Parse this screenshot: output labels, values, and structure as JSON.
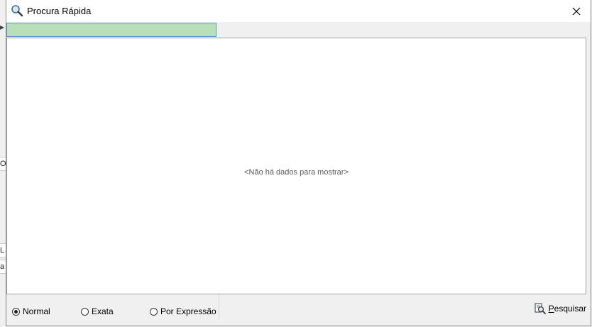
{
  "window": {
    "title": "Procura Rápida",
    "title_icon": "magnifier-icon",
    "close_icon": "close-icon"
  },
  "search": {
    "value": "",
    "placeholder": "",
    "background_color": "#b9dfb9",
    "border_color": "#5b8fd6"
  },
  "grid": {
    "empty_message": "<Não há dados para mostrar>"
  },
  "search_mode": {
    "options": [
      {
        "label": "Normal",
        "selected": true
      },
      {
        "label": "Exata",
        "selected": false
      },
      {
        "label": "Por Expressão",
        "selected": false
      }
    ]
  },
  "search_button": {
    "label_first": "P",
    "label_rest": "esquisar",
    "icon": "search-document-icon"
  },
  "background": {
    "fragments": [
      "O",
      "L",
      "a"
    ]
  }
}
